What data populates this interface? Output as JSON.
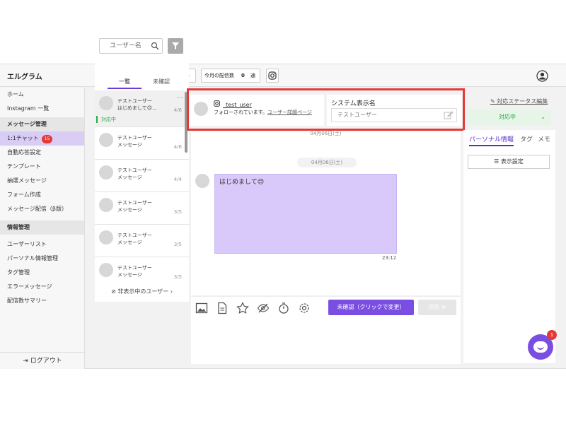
{
  "header": {
    "brand": "エルグラム",
    "counter_label": "今月の配信数",
    "counter_value": "0",
    "counter_unit": "通"
  },
  "sidebar": {
    "items": [
      {
        "label": "ホーム",
        "type": "item"
      },
      {
        "label": "Instagram 一覧",
        "type": "item"
      },
      {
        "label": "メッセージ管理",
        "type": "section"
      },
      {
        "label": "1:1チャット",
        "type": "active",
        "badge": "15"
      },
      {
        "label": "自動応答設定",
        "type": "item"
      },
      {
        "label": "テンプレート",
        "type": "item"
      },
      {
        "label": "抽選メッセージ",
        "type": "item"
      },
      {
        "label": "フォーム作成",
        "type": "item"
      },
      {
        "label": "メッセージ配信（β版）",
        "type": "item"
      },
      {
        "label": "情報管理",
        "type": "section"
      },
      {
        "label": "ユーザーリスト",
        "type": "item"
      },
      {
        "label": "パーソナル情報管理",
        "type": "item"
      },
      {
        "label": "タグ管理",
        "type": "item"
      },
      {
        "label": "エラーメッセージ",
        "type": "item"
      },
      {
        "label": "配信数サマリー",
        "type": "item"
      }
    ],
    "logout_label": "ログアウト"
  },
  "list": {
    "search_placeholder": "ユーザー名",
    "tab_all": "一覧",
    "tab_unconfirmed": "未確認",
    "hidden_users_label": "非表示中のユーザー",
    "items": [
      {
        "name": "テストユーザー",
        "message": "はじめまして😊...",
        "date": "4/6",
        "status": "対応中"
      },
      {
        "name": "テストユーザー",
        "message": "メッセージ",
        "date": "4/6"
      },
      {
        "name": "テストユーザー",
        "message": "メッセージ",
        "date": "4/4"
      },
      {
        "name": "テストユーザー",
        "message": "メッセージ",
        "date": "3/5"
      },
      {
        "name": "テストユーザー",
        "message": "メッセージ",
        "date": "3/5"
      },
      {
        "name": "テストユーザー",
        "message": "メッセージ",
        "date": "3/5"
      }
    ]
  },
  "profile": {
    "instagram_name": "_test_user",
    "follow_text": "フォローされています。",
    "detail_link": "ユーザー詳細ページ",
    "system_name_label": "システム表示名",
    "system_name_value": "テストユーザー"
  },
  "chat": {
    "date_top": "04月06日(土)",
    "date_divider": "04月06日(土)",
    "message": "はじめまして😊",
    "time": "23:12"
  },
  "composer": {
    "unconfirmed_button": "未確認（クリックで変更）",
    "send_button": "送信 ➤"
  },
  "right": {
    "edit_status_link": "対応ステータス編集",
    "status_value": "対応中",
    "tab_personal": "パーソナル情報",
    "tab_tag": "タグ",
    "tab_memo": "メモ",
    "display_settings": "表示設定"
  },
  "notification_count": "1"
}
